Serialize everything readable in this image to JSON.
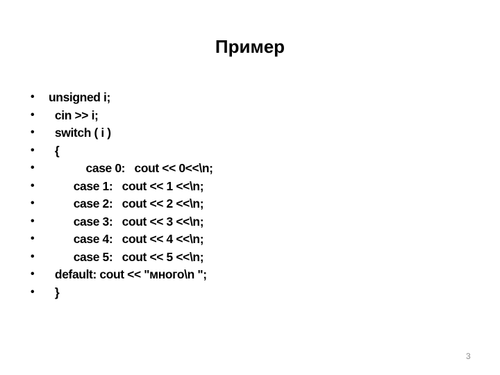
{
  "slide": {
    "title": "Пример",
    "lines": [
      "unsigned i;",
      "  cin >> i;",
      "  switch ( i )",
      "  {",
      "            case 0:   cout << 0<<\\n;",
      "        case 1:   cout << 1 <<\\n;",
      "        case 2:   cout << 2 <<\\n;",
      "        case 3:   cout << 3 <<\\n;",
      "        case 4:   cout << 4 <<\\n;",
      "        case 5:   cout << 5 <<\\n;",
      "  default: cout << \"много\\n \";",
      "  }"
    ],
    "bullet": "•",
    "page_number": "3"
  }
}
